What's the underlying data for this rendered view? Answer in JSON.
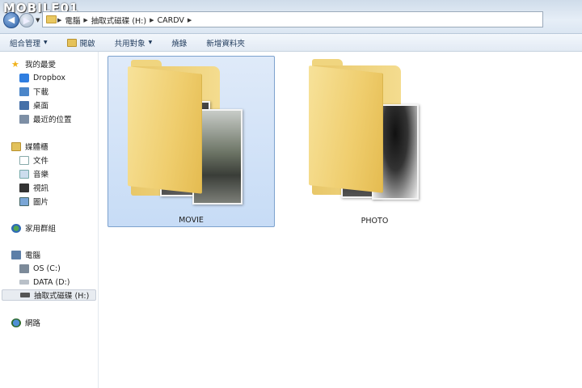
{
  "watermark": "MOBILE01",
  "address": {
    "crumbs": [
      "電腦",
      "抽取式磁碟 (H:)",
      "CARDV"
    ]
  },
  "toolbar": {
    "organize": "組合管理",
    "open": "開啟",
    "share": "共用對象",
    "burn": "燒錄",
    "new_folder": "新增資料夾"
  },
  "sidebar": {
    "favorites": "我的最愛",
    "dropbox": "Dropbox",
    "downloads": "下載",
    "desktop": "桌面",
    "recent": "最近的位置",
    "libraries": "媒體櫃",
    "documents": "文件",
    "music": "音樂",
    "videos": "視訊",
    "pictures": "圖片",
    "homegroup": "家用群組",
    "computer": "電腦",
    "drive_c": "OS (C:)",
    "drive_d": "DATA (D:)",
    "drive_h": "抽取式磁碟 (H:)",
    "network": "網路"
  },
  "content": {
    "items": [
      {
        "name": "MOVIE",
        "selected": true
      },
      {
        "name": "PHOTO",
        "selected": false
      }
    ]
  },
  "icons": {
    "back": "back-arrow-icon",
    "forward": "forward-arrow-icon",
    "folder": "folder-icon"
  }
}
